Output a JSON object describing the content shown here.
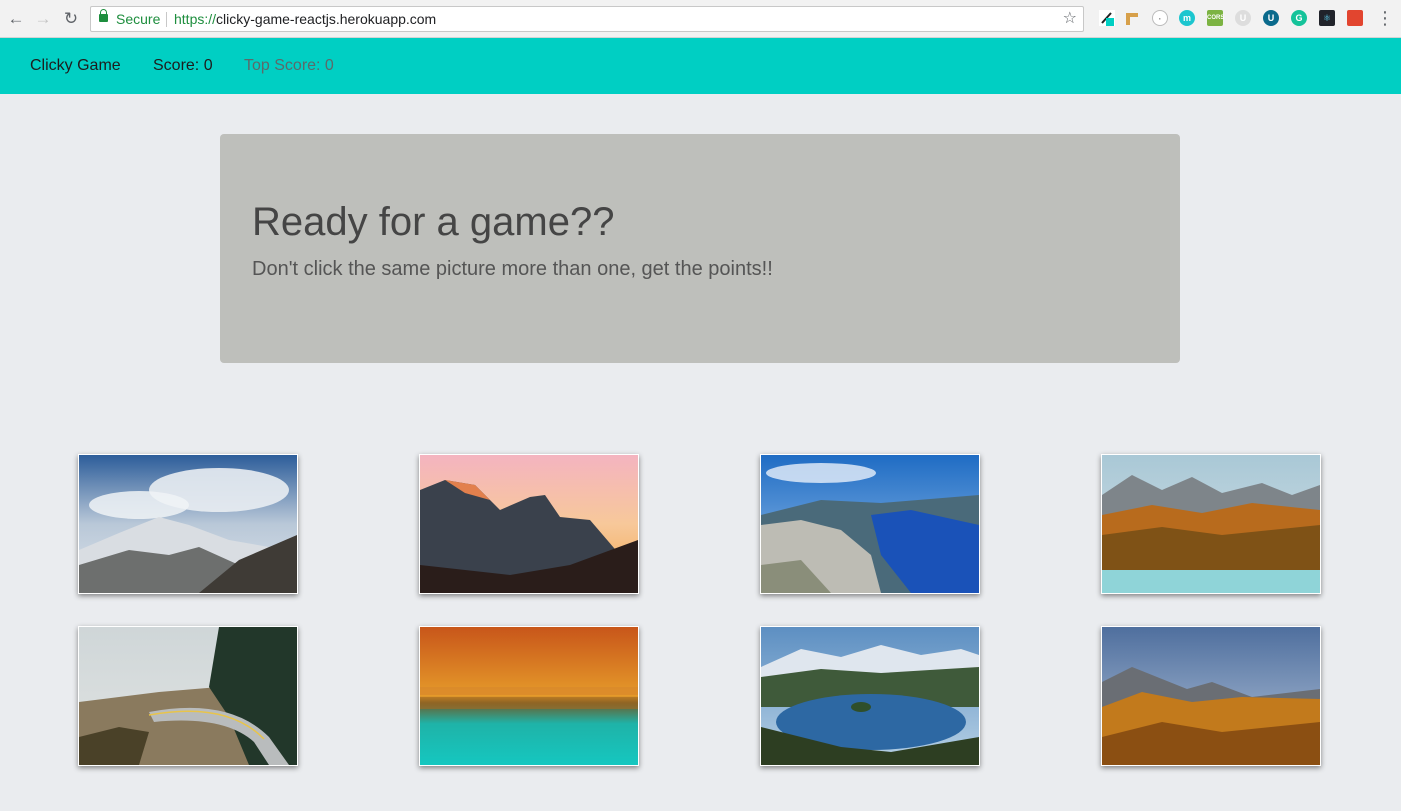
{
  "browser": {
    "secure_label": "Secure",
    "url_protocol": "https://",
    "url_rest": "clicky-game-reactjs.herokuapp.com"
  },
  "navbar": {
    "brand": "Clicky Game",
    "score": "Score: 0",
    "top_score": "Top Score: 0"
  },
  "jumbotron": {
    "title": "Ready for a game??",
    "subtitle": "Don't click the same picture more than one, get the points!!"
  },
  "images": [
    {
      "name": "snowy-mountains-image"
    },
    {
      "name": "sunset-peaks-image"
    },
    {
      "name": "fjord-cliff-image"
    },
    {
      "name": "autumn-lake-mountains-image"
    },
    {
      "name": "viaduct-road-image"
    },
    {
      "name": "orange-forest-reflection-image"
    },
    {
      "name": "lake-island-image"
    },
    {
      "name": "golden-larch-forest-image"
    }
  ],
  "colors": {
    "navbar": "#00cfc3",
    "background": "#eaecef",
    "jumbotron": "#bebfbb"
  }
}
